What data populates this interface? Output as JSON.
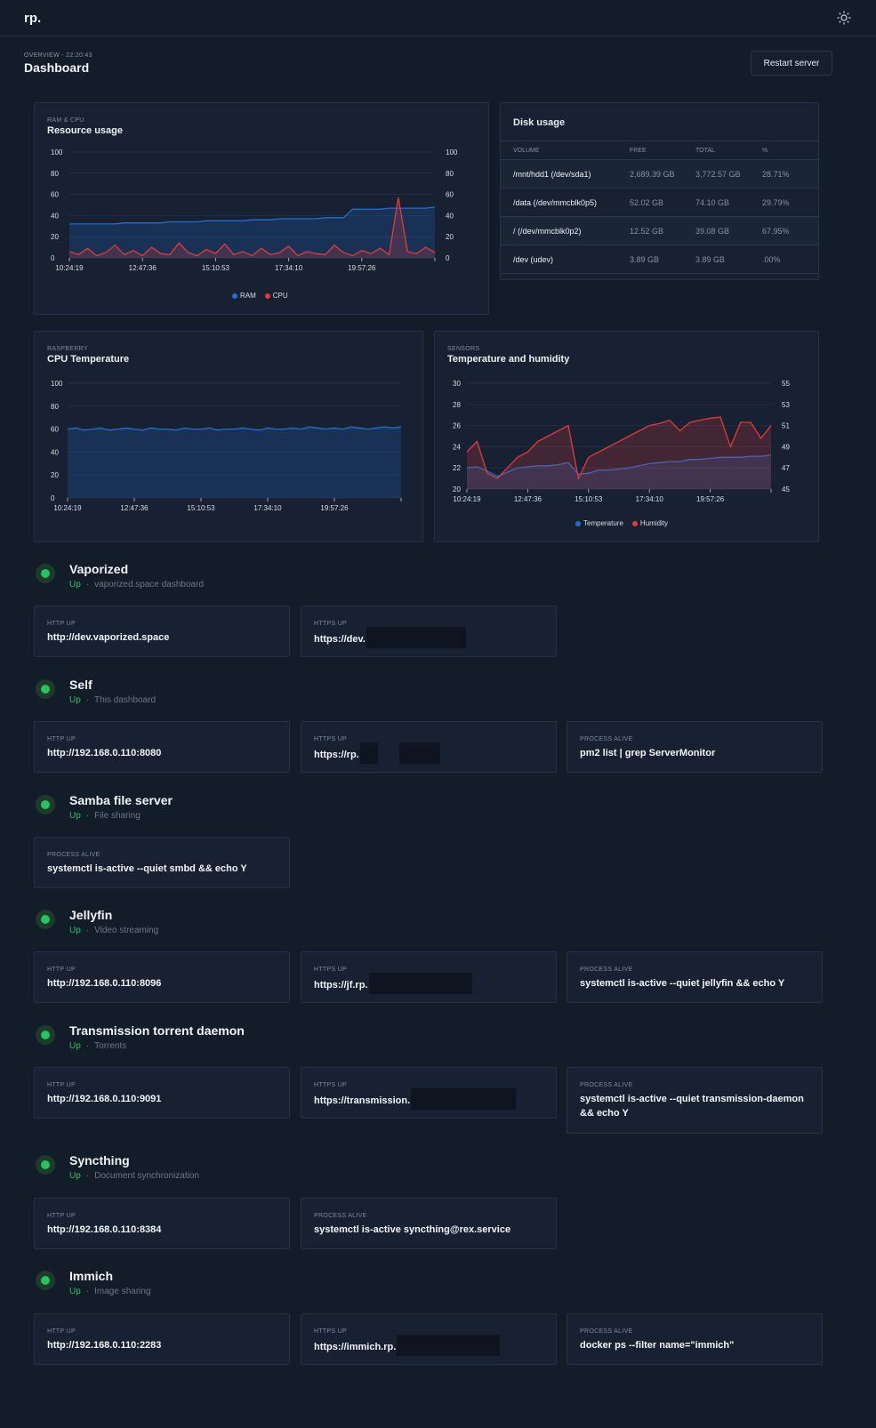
{
  "app": {
    "logo": "rp.",
    "theme_icon": "sun-icon"
  },
  "header": {
    "overline": "OVERVIEW - 22:20:43",
    "title": "Dashboard",
    "restart_label": "Restart server"
  },
  "resource": {
    "overline": "RAM & CPU",
    "title": "Resource usage",
    "legend": [
      "RAM",
      "CPU"
    ]
  },
  "disk": {
    "title": "Disk usage",
    "columns": [
      "VOLUME",
      "FREE",
      "TOTAL",
      "%"
    ],
    "rows": [
      [
        "/mnt/hdd1 (/dev/sda1)",
        "2,689.39 GB",
        "3,772.57 GB",
        "28.71%"
      ],
      [
        "/data (/dev/mmcblk0p5)",
        "52.02 GB",
        "74.10 GB",
        "29.79%"
      ],
      [
        "/ (/dev/mmcblk0p2)",
        "12.52 GB",
        "39.08 GB",
        "67.95%"
      ],
      [
        "/dev (udev)",
        "3.89 GB",
        "3.89 GB",
        ".00%"
      ]
    ]
  },
  "cputemp": {
    "overline": "RASPBERRY",
    "title": "CPU Temperature"
  },
  "sensors": {
    "overline": "SENSORS",
    "title": "Temperature and humidity",
    "legend": [
      "Temperature",
      "Humidity"
    ]
  },
  "services": [
    {
      "name": "Vaporized",
      "status": "Up",
      "desc": "vaporized.space dashboard",
      "checks": [
        {
          "label": "HTTP UP",
          "value": "http://dev.vaporized.space"
        },
        {
          "label": "HTTPS UP",
          "value": "https://dev."
        }
      ]
    },
    {
      "name": "Self",
      "status": "Up",
      "desc": "This dashboard",
      "checks": [
        {
          "label": "HTTP UP",
          "value": "http://192.168.0.110:8080"
        },
        {
          "label": "HTTPS UP",
          "value": "https://rp."
        },
        {
          "label": "PROCESS ALIVE",
          "value": "pm2 list | grep ServerMonitor"
        }
      ]
    },
    {
      "name": "Samba file server",
      "status": "Up",
      "desc": "File sharing",
      "checks": [
        {
          "label": "PROCESS ALIVE",
          "value": "systemctl is-active --quiet smbd && echo Y"
        }
      ]
    },
    {
      "name": "Jellyfin",
      "status": "Up",
      "desc": "Video streaming",
      "checks": [
        {
          "label": "HTTP UP",
          "value": "http://192.168.0.110:8096"
        },
        {
          "label": "HTTPS UP",
          "value": "https://jf.rp."
        },
        {
          "label": "PROCESS ALIVE",
          "value": "systemctl is-active --quiet jellyfin && echo Y"
        }
      ]
    },
    {
      "name": "Transmission torrent daemon",
      "status": "Up",
      "desc": "Torrents",
      "checks": [
        {
          "label": "HTTP UP",
          "value": "http://192.168.0.110:9091"
        },
        {
          "label": "HTTPS UP",
          "value": "https://transmission."
        },
        {
          "label": "PROCESS ALIVE",
          "value": "systemctl is-active --quiet transmission-daemon && echo Y"
        }
      ]
    },
    {
      "name": "Syncthing",
      "status": "Up",
      "desc": "Document synchronization",
      "checks": [
        {
          "label": "HTTP UP",
          "value": "http://192.168.0.110:8384"
        },
        {
          "label": "PROCESS ALIVE",
          "value": "systemctl is-active syncthing@rex.service"
        }
      ]
    },
    {
      "name": "Immich",
      "status": "Up",
      "desc": "Image sharing",
      "checks": [
        {
          "label": "HTTP UP",
          "value": "http://192.168.0.110:2283"
        },
        {
          "label": "HTTPS UP",
          "value": "https://immich.rp."
        },
        {
          "label": "PROCESS ALIVE",
          "value": "docker ps --filter name=\"immich\""
        }
      ]
    }
  ],
  "chart_data": [
    {
      "type": "line",
      "title": "Resource usage",
      "x_ticks": [
        "10:24:19",
        "12:47:36",
        "15:10:53",
        "17:34:10",
        "19:57:26"
      ],
      "ylim": [
        0,
        100
      ],
      "y2lim": [
        0,
        100
      ],
      "y_ticks": [
        0,
        20,
        40,
        60,
        80,
        100
      ],
      "grid": true,
      "legend": "bottom",
      "colors": {
        "RAM": "#1f6fd1",
        "CPU": "#e23b3b"
      },
      "series": [
        {
          "name": "RAM",
          "values": [
            32,
            32,
            32,
            32,
            32,
            32,
            33,
            33,
            33,
            33,
            33,
            34,
            34,
            34,
            34,
            35,
            35,
            35,
            35,
            35,
            36,
            36,
            36,
            37,
            37,
            37,
            37,
            37,
            38,
            38,
            38,
            46,
            46,
            46,
            46,
            47,
            47,
            47,
            47,
            47,
            48
          ]
        },
        {
          "name": "CPU",
          "values": [
            6,
            3,
            9,
            2,
            5,
            12,
            3,
            7,
            2,
            10,
            4,
            3,
            14,
            5,
            2,
            8,
            4,
            13,
            3,
            6,
            2,
            9,
            3,
            5,
            11,
            2,
            6,
            4,
            3,
            12,
            5,
            2,
            7,
            4,
            9,
            3,
            57,
            6,
            4,
            10,
            5
          ]
        }
      ]
    },
    {
      "type": "area",
      "title": "CPU Temperature",
      "x_ticks": [
        "10:24:19",
        "12:47:36",
        "15:10:53",
        "17:34:10",
        "19:57:26"
      ],
      "ylim": [
        0,
        100
      ],
      "y_ticks": [
        0,
        20,
        40,
        60,
        80,
        100
      ],
      "grid": true,
      "colors": {
        "temperature": "#1f6fd1"
      },
      "series": [
        {
          "values": [
            60,
            61,
            59,
            60,
            61,
            59,
            60,
            61,
            60,
            59,
            61,
            60,
            60,
            59,
            61,
            60,
            60,
            61,
            59,
            60,
            60,
            61,
            60,
            59,
            61,
            60,
            60,
            61,
            60,
            62,
            61,
            60,
            61,
            60,
            62,
            61,
            60,
            61,
            62,
            61,
            62
          ]
        }
      ]
    },
    {
      "type": "area",
      "title": "Temperature and humidity",
      "x_ticks": [
        "10:24:19",
        "12:47:36",
        "15:10:53",
        "17:34:10",
        "19:57:26"
      ],
      "ylim": [
        20,
        30
      ],
      "y_ticks": [
        20,
        22,
        24,
        26,
        28,
        30
      ],
      "y2lim": [
        45,
        55
      ],
      "y2_ticks": [
        45,
        47,
        49,
        51,
        53,
        55
      ],
      "grid": true,
      "legend": "bottom",
      "colors": {
        "Temperature": "#1f6fd1",
        "Humidity": "#e23b3b"
      },
      "series": [
        {
          "name": "Temperature",
          "axis": "left",
          "values": [
            22.0,
            22.1,
            21.7,
            21.2,
            21.6,
            22.0,
            22.1,
            22.2,
            22.2,
            22.3,
            22.5,
            21.4,
            21.5,
            21.8,
            21.8,
            21.9,
            22.0,
            22.2,
            22.4,
            22.5,
            22.6,
            22.6,
            22.8,
            22.8,
            22.9,
            23.0,
            23.0,
            23.0,
            23.1,
            23.1,
            23.2
          ]
        },
        {
          "name": "Humidity",
          "axis": "right",
          "values": [
            48.5,
            49.5,
            46.5,
            46.0,
            47.0,
            48.0,
            48.5,
            49.5,
            50.0,
            50.5,
            51.0,
            46.0,
            48.0,
            48.5,
            49.0,
            49.5,
            50.0,
            50.5,
            51.0,
            51.2,
            51.5,
            50.5,
            51.3,
            51.5,
            51.7,
            51.8,
            49.0,
            51.3,
            51.3,
            49.8,
            51.0
          ]
        }
      ]
    }
  ]
}
